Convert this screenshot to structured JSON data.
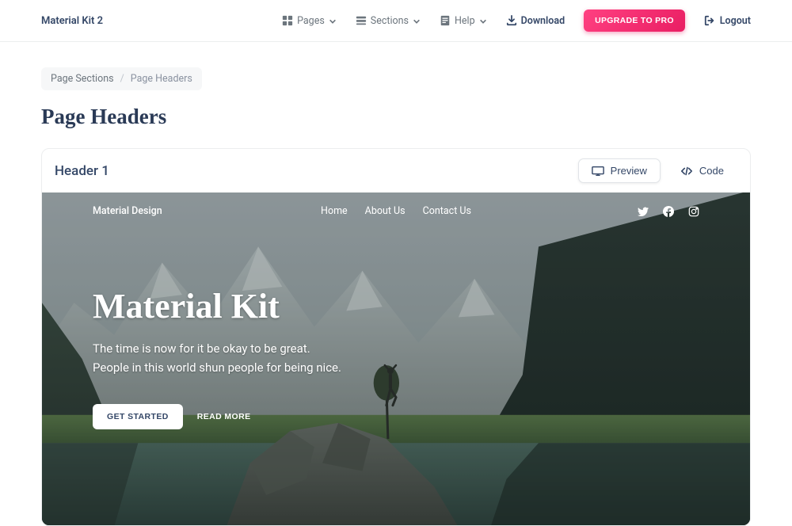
{
  "topnav": {
    "brand": "Material Kit 2",
    "items": {
      "pages": "Pages",
      "sections": "Sections",
      "help": "Help",
      "download": "Download",
      "upgrade": "UPGRADE TO PRO",
      "logout": "Logout"
    }
  },
  "breadcrumb": {
    "parent": "Page Sections",
    "current": "Page Headers"
  },
  "page_title": "Page Headers",
  "card": {
    "title": "Header 1",
    "toggle": {
      "preview": "Preview",
      "code": "Code"
    }
  },
  "hero": {
    "brand": "Material Design",
    "links": {
      "home": "Home",
      "about": "About Us",
      "contact": "Contact Us"
    },
    "title": "Material Kit",
    "subtitle": "The time is now for it be okay to be great. People in this world shun people for being nice.",
    "buttons": {
      "primary": "GET STARTED",
      "secondary": "READ MORE"
    }
  },
  "colors": {
    "accent": "#e91e63",
    "text_primary": "#344767",
    "text_muted": "#6c757d"
  }
}
